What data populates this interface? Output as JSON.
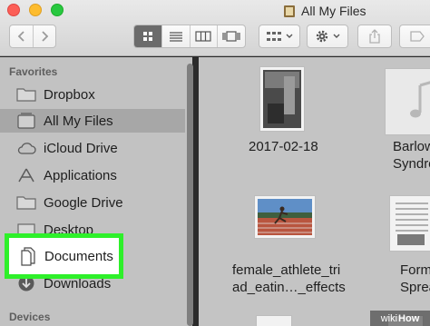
{
  "window": {
    "title": "All My Files"
  },
  "toolbar": {
    "back_icon": "chevron-left-icon",
    "forward_icon": "chevron-right-icon",
    "view_modes": [
      "icon-view",
      "list-view",
      "column-view",
      "cover-flow-view"
    ],
    "active_view": "icon-view",
    "arrange_icon": "arrange-grid-icon",
    "action_icon": "gear-icon",
    "share_icon": "share-icon",
    "tag_icon": "tag-icon"
  },
  "sidebar": {
    "favorites_heading": "Favorites",
    "items": [
      {
        "label": "Dropbox",
        "icon": "folder-icon"
      },
      {
        "label": "All My Files",
        "icon": "all-files-icon",
        "selected": true
      },
      {
        "label": "iCloud Drive",
        "icon": "cloud-icon"
      },
      {
        "label": "Applications",
        "icon": "applications-icon"
      },
      {
        "label": "Google Drive",
        "icon": "folder-icon"
      },
      {
        "label": "Desktop",
        "icon": "desktop-icon"
      },
      {
        "label": "Documents",
        "icon": "document-icon",
        "highlighted": true
      },
      {
        "label": "Downloads",
        "icon": "download-icon"
      }
    ],
    "devices_heading": "Devices"
  },
  "files": [
    {
      "name_line1": "2017-02-18",
      "name_line2": "",
      "kind": "photo"
    },
    {
      "name_line1": "Barlow",
      "name_line2": "Syndro",
      "kind": "audio"
    },
    {
      "name_line1": "female_athlete_tri",
      "name_line2": "ad_eatin…_effects",
      "kind": "image"
    },
    {
      "name_line1": "Form",
      "name_line2": "Spreads",
      "kind": "spreadsheet"
    }
  ],
  "watermark": {
    "prefix": "wiki",
    "suffix": "How"
  },
  "colors": {
    "highlight": "#2ef02a",
    "selected_row": "#a7a7a7"
  }
}
